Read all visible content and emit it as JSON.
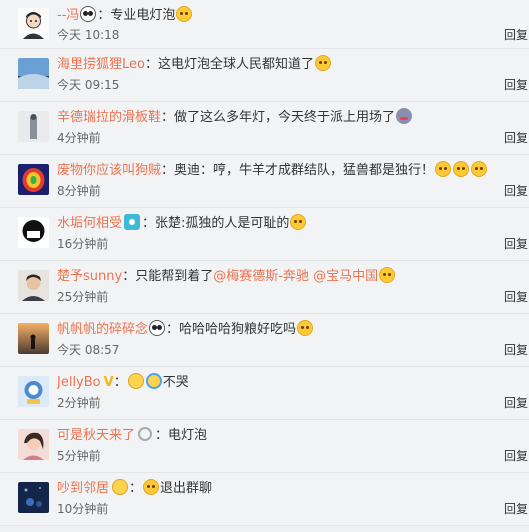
{
  "comments": [
    {
      "user": "--冯",
      "sep": "：",
      "text": "专业电灯泡",
      "time": "今天 10:18",
      "reply": "回复"
    },
    {
      "user": "海里捞狐狸Leo",
      "sep": "：",
      "text": "这电灯泡全球人民都知道了",
      "time": "今天 09:15",
      "reply": "回复"
    },
    {
      "user": "辛德瑞拉的滑板鞋",
      "sep": "：",
      "text": "做了这么多年灯，今天终于派上用场了",
      "time": "4分钟前",
      "reply": "回复"
    },
    {
      "user": "废物你应该叫狗贼",
      "sep": "：",
      "text": "奥迪：哼，牛羊才成群结队，猛兽都是独行！",
      "time": "8分钟前",
      "reply": "回复"
    },
    {
      "user": "水垢何相受",
      "sep": "：",
      "text": "张楚:孤独的人是可耻的",
      "time": "16分钟前",
      "reply": "回复"
    },
    {
      "user": "楚予sunny",
      "sep": "：",
      "text": "只能帮到着了",
      "mention1": "@梅赛德斯-奔驰",
      "mention2": "@宝马中国",
      "time": "25分钟前",
      "reply": "回复"
    },
    {
      "user": "帆帆帆的碎碎念",
      "sep": "：",
      "text": "哈哈哈哈狗粮好吃吗",
      "time": "今天 08:57",
      "reply": "回复"
    },
    {
      "user": "JellyBo",
      "sep": "：",
      "text": "不哭",
      "time": "2分钟前",
      "reply": "回复"
    },
    {
      "user": "可是秋天来了",
      "sep": "：",
      "text": "电灯泡",
      "time": "5分钟前",
      "reply": "回复"
    },
    {
      "user": "吵到邻居",
      "sep": "：",
      "text": "退出群聊",
      "time": "10分钟前",
      "reply": "回复"
    }
  ],
  "badges": {
    "vip": "V"
  },
  "colors": {
    "username": "#eb7350",
    "background": "#f2f3f5"
  }
}
